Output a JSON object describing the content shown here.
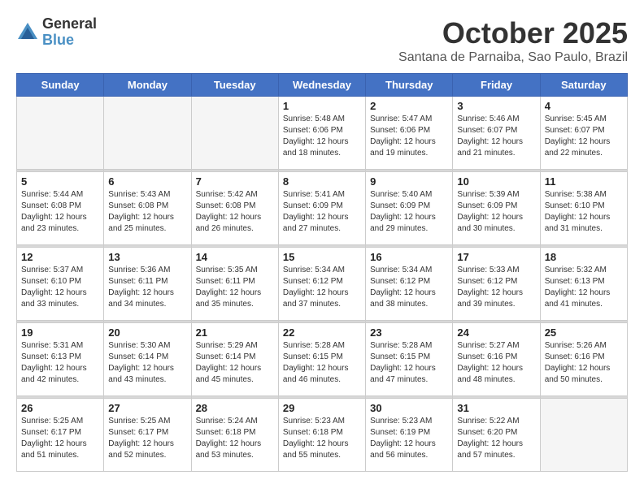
{
  "header": {
    "logo_general": "General",
    "logo_blue": "Blue",
    "month_title": "October 2025",
    "subtitle": "Santana de Parnaiba, Sao Paulo, Brazil"
  },
  "weekdays": [
    "Sunday",
    "Monday",
    "Tuesday",
    "Wednesday",
    "Thursday",
    "Friday",
    "Saturday"
  ],
  "weeks": [
    [
      {
        "day": "",
        "info": ""
      },
      {
        "day": "",
        "info": ""
      },
      {
        "day": "",
        "info": ""
      },
      {
        "day": "1",
        "info": "Sunrise: 5:48 AM\nSunset: 6:06 PM\nDaylight: 12 hours\nand 18 minutes."
      },
      {
        "day": "2",
        "info": "Sunrise: 5:47 AM\nSunset: 6:06 PM\nDaylight: 12 hours\nand 19 minutes."
      },
      {
        "day": "3",
        "info": "Sunrise: 5:46 AM\nSunset: 6:07 PM\nDaylight: 12 hours\nand 21 minutes."
      },
      {
        "day": "4",
        "info": "Sunrise: 5:45 AM\nSunset: 6:07 PM\nDaylight: 12 hours\nand 22 minutes."
      }
    ],
    [
      {
        "day": "5",
        "info": "Sunrise: 5:44 AM\nSunset: 6:08 PM\nDaylight: 12 hours\nand 23 minutes."
      },
      {
        "day": "6",
        "info": "Sunrise: 5:43 AM\nSunset: 6:08 PM\nDaylight: 12 hours\nand 25 minutes."
      },
      {
        "day": "7",
        "info": "Sunrise: 5:42 AM\nSunset: 6:08 PM\nDaylight: 12 hours\nand 26 minutes."
      },
      {
        "day": "8",
        "info": "Sunrise: 5:41 AM\nSunset: 6:09 PM\nDaylight: 12 hours\nand 27 minutes."
      },
      {
        "day": "9",
        "info": "Sunrise: 5:40 AM\nSunset: 6:09 PM\nDaylight: 12 hours\nand 29 minutes."
      },
      {
        "day": "10",
        "info": "Sunrise: 5:39 AM\nSunset: 6:09 PM\nDaylight: 12 hours\nand 30 minutes."
      },
      {
        "day": "11",
        "info": "Sunrise: 5:38 AM\nSunset: 6:10 PM\nDaylight: 12 hours\nand 31 minutes."
      }
    ],
    [
      {
        "day": "12",
        "info": "Sunrise: 5:37 AM\nSunset: 6:10 PM\nDaylight: 12 hours\nand 33 minutes."
      },
      {
        "day": "13",
        "info": "Sunrise: 5:36 AM\nSunset: 6:11 PM\nDaylight: 12 hours\nand 34 minutes."
      },
      {
        "day": "14",
        "info": "Sunrise: 5:35 AM\nSunset: 6:11 PM\nDaylight: 12 hours\nand 35 minutes."
      },
      {
        "day": "15",
        "info": "Sunrise: 5:34 AM\nSunset: 6:12 PM\nDaylight: 12 hours\nand 37 minutes."
      },
      {
        "day": "16",
        "info": "Sunrise: 5:34 AM\nSunset: 6:12 PM\nDaylight: 12 hours\nand 38 minutes."
      },
      {
        "day": "17",
        "info": "Sunrise: 5:33 AM\nSunset: 6:12 PM\nDaylight: 12 hours\nand 39 minutes."
      },
      {
        "day": "18",
        "info": "Sunrise: 5:32 AM\nSunset: 6:13 PM\nDaylight: 12 hours\nand 41 minutes."
      }
    ],
    [
      {
        "day": "19",
        "info": "Sunrise: 5:31 AM\nSunset: 6:13 PM\nDaylight: 12 hours\nand 42 minutes."
      },
      {
        "day": "20",
        "info": "Sunrise: 5:30 AM\nSunset: 6:14 PM\nDaylight: 12 hours\nand 43 minutes."
      },
      {
        "day": "21",
        "info": "Sunrise: 5:29 AM\nSunset: 6:14 PM\nDaylight: 12 hours\nand 45 minutes."
      },
      {
        "day": "22",
        "info": "Sunrise: 5:28 AM\nSunset: 6:15 PM\nDaylight: 12 hours\nand 46 minutes."
      },
      {
        "day": "23",
        "info": "Sunrise: 5:28 AM\nSunset: 6:15 PM\nDaylight: 12 hours\nand 47 minutes."
      },
      {
        "day": "24",
        "info": "Sunrise: 5:27 AM\nSunset: 6:16 PM\nDaylight: 12 hours\nand 48 minutes."
      },
      {
        "day": "25",
        "info": "Sunrise: 5:26 AM\nSunset: 6:16 PM\nDaylight: 12 hours\nand 50 minutes."
      }
    ],
    [
      {
        "day": "26",
        "info": "Sunrise: 5:25 AM\nSunset: 6:17 PM\nDaylight: 12 hours\nand 51 minutes."
      },
      {
        "day": "27",
        "info": "Sunrise: 5:25 AM\nSunset: 6:17 PM\nDaylight: 12 hours\nand 52 minutes."
      },
      {
        "day": "28",
        "info": "Sunrise: 5:24 AM\nSunset: 6:18 PM\nDaylight: 12 hours\nand 53 minutes."
      },
      {
        "day": "29",
        "info": "Sunrise: 5:23 AM\nSunset: 6:18 PM\nDaylight: 12 hours\nand 55 minutes."
      },
      {
        "day": "30",
        "info": "Sunrise: 5:23 AM\nSunset: 6:19 PM\nDaylight: 12 hours\nand 56 minutes."
      },
      {
        "day": "31",
        "info": "Sunrise: 5:22 AM\nSunset: 6:20 PM\nDaylight: 12 hours\nand 57 minutes."
      },
      {
        "day": "",
        "info": ""
      }
    ]
  ]
}
